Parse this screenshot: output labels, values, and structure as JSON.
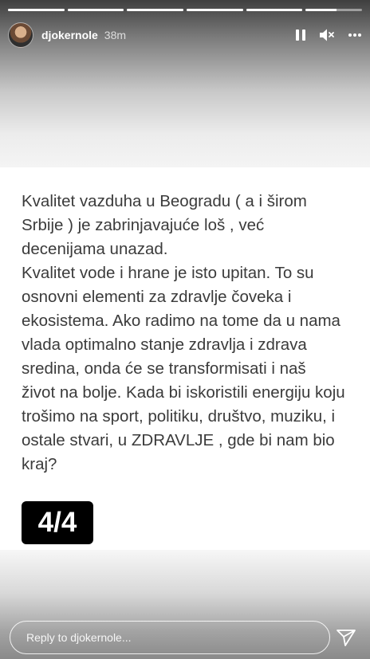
{
  "progress": {
    "segments": 6,
    "completed": 5,
    "current_fraction": 0.55
  },
  "header": {
    "username": "djokernole",
    "time": "38m",
    "icons": [
      "pause-icon",
      "mute-icon",
      "more-icon"
    ]
  },
  "story": {
    "lines": [
      "Kvalitet vazduha u Beogradu ( a i širom",
      "Srbije ) je zabrinjavajuće loš , već",
      "decenijama unazad.",
      "Kvalitet vode i hrane je isto upitan. To su",
      "osnovni elementi za zdravlje čoveka i",
      "ekosistema. Ako radimo na tome da u nama",
      "vlada optimalno stanje zdravlja i zdrava",
      "sredina, onda će se transformisati i naš",
      "život na bolje. Kada bi iskoristili energiju koju",
      "trošimo na  sport, politiku, društvo, muziku, i",
      "ostale stvari, u ZDRAVLJE , gde bi nam bio",
      "kraj?"
    ],
    "badge": "4/4"
  },
  "reply": {
    "placeholder": "Reply to djokernole..."
  },
  "colors": {
    "text": "#3b3b3b",
    "badge_bg": "#000000",
    "badge_text": "#ffffff"
  }
}
